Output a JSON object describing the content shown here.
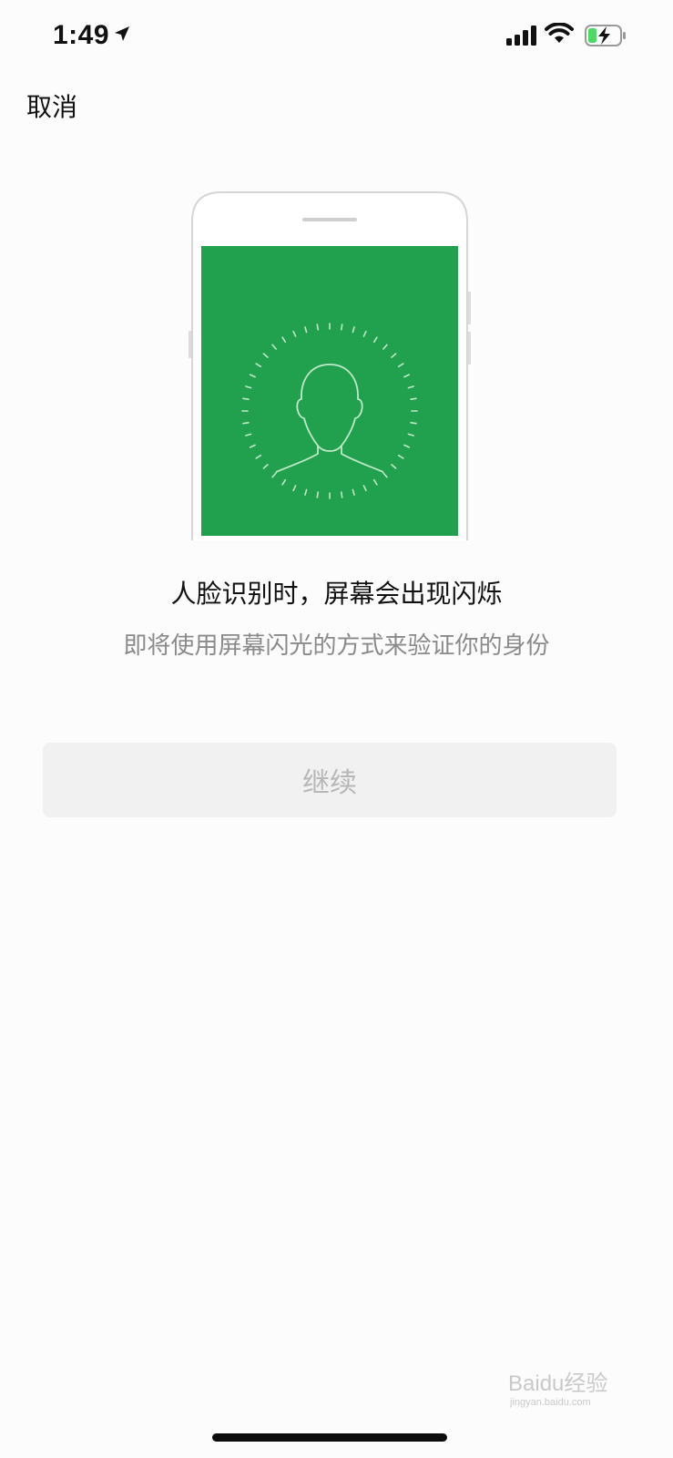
{
  "status_bar": {
    "time": "1:49",
    "icons": [
      "location-arrow-icon",
      "signal-bars-icon",
      "wifi-icon",
      "battery-charging-icon"
    ]
  },
  "nav": {
    "cancel_label": "取消"
  },
  "illustration": {
    "screen_color": "#21a04d",
    "icon": "face-silhouette-icon"
  },
  "main": {
    "title": "人脸识别时，屏幕会出现闪烁",
    "subtitle": "即将使用屏幕闪光的方式来验证你的身份"
  },
  "actions": {
    "continue_label": "继续"
  },
  "watermark": {
    "brand": "Baidu经验",
    "url": "jingyan.baidu.com"
  },
  "colors": {
    "accent_green": "#21a04d",
    "button_bg": "#f1f1f1",
    "button_text_disabled": "#b7b7b7",
    "subtitle_text": "#8a8a8a"
  }
}
